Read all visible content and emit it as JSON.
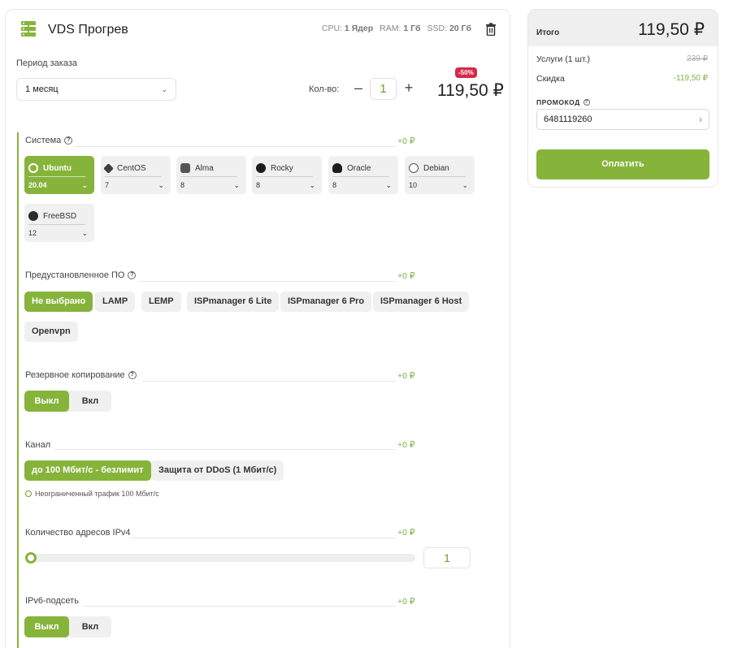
{
  "product": {
    "title": "VDS Прогрев",
    "specs": [
      {
        "label": "CPU:",
        "value": "1 Ядер"
      },
      {
        "label": "RAM:",
        "value": "1 Гб"
      },
      {
        "label": "SSD:",
        "value": "20 Гб"
      }
    ]
  },
  "order": {
    "period_label": "Период заказа",
    "period_value": "1 месяц",
    "qty_label": "Кол-во:",
    "qty_minus": "–",
    "qty_value": "1",
    "qty_plus": "+",
    "discount_badge": "-50%",
    "price": "119,50 ₽"
  },
  "sections": {
    "system": {
      "label": "Система",
      "price": "+0 ₽"
    },
    "software": {
      "label": "Предустановленное ПО",
      "price": "+0 ₽"
    },
    "backup": {
      "label": "Резервное копирование",
      "price": "+0 ₽"
    },
    "channel": {
      "label": "Канал",
      "price": "+0 ₽"
    },
    "ipv4": {
      "label": "Количество адресов IPv4",
      "price": "+0 ₽"
    },
    "ipv6": {
      "label": "IPv6-подсеть",
      "price": "+0 ₽"
    }
  },
  "os_list": [
    {
      "name": "Ubuntu",
      "version": "20.04",
      "active": true,
      "color": "#e9f1dc"
    },
    {
      "name": "CentOS",
      "version": "7",
      "active": false,
      "color": "#3f3f3f"
    },
    {
      "name": "Alma",
      "version": "8",
      "active": false,
      "color": "#555555"
    },
    {
      "name": "Rocky",
      "version": "8",
      "active": false,
      "color": "#1d1d1d"
    },
    {
      "name": "Oracle",
      "version": "8",
      "active": false,
      "color": "#1d1d1d"
    },
    {
      "name": "Debian",
      "version": "10",
      "active": false,
      "color": "#ffffff"
    },
    {
      "name": "FreeBSD",
      "version": "12",
      "active": false,
      "color": "#2b2b2b"
    }
  ],
  "software_chips": [
    {
      "label": "Не выбрано",
      "active": true
    },
    {
      "label": "LAMP",
      "active": false
    },
    {
      "label": "LEMP",
      "active": false
    },
    {
      "label": "ISPmanager 6 Lite",
      "active": false
    },
    {
      "label": "ISPmanager 6 Pro",
      "active": false
    },
    {
      "label": "ISPmanager 6 Host",
      "active": false
    },
    {
      "label": "Openvpn",
      "active": false
    }
  ],
  "backup_toggle": {
    "off": "Выкл",
    "on": "Вкл"
  },
  "channel_chips": [
    {
      "label": "до 100 Мбит/с - безлимит",
      "active": true
    },
    {
      "label": "Защита от DDoS (1 Мбит/с)",
      "active": false
    }
  ],
  "channel_note": "Неограниченный трафик 100 Мбит/с",
  "ipv4": {
    "value": "1",
    "level": 0
  },
  "ipv6_toggle": {
    "off": "Выкл",
    "on": "Вкл"
  },
  "summary": {
    "title": "Итого",
    "total": "119,50 ₽",
    "services_label": "Услуги (1 шт.)",
    "services_value": "239 ₽",
    "discount_label": "Скидка",
    "discount_value": "-119,50 ₽",
    "promo_label": "ПРОМОКОД",
    "promo_value": "6481119260",
    "pay_label": "Оплатить"
  },
  "colors": {
    "accent": "#86b43b",
    "accent_text": "#7bb142",
    "badge": "#d6294a"
  }
}
